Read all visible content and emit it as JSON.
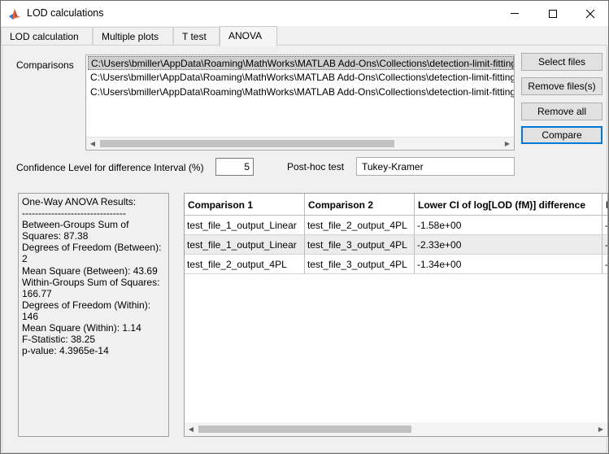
{
  "window": {
    "title": "LOD calculations",
    "icon": "matlab-icon"
  },
  "tabs": [
    {
      "label": "LOD calculation",
      "active": false
    },
    {
      "label": "Multiple plots",
      "active": false
    },
    {
      "label": "T test",
      "active": false
    },
    {
      "label": "ANOVA",
      "active": true
    }
  ],
  "comparisons": {
    "label": "Comparisons",
    "files": [
      "C:\\Users\\bmiller\\AppData\\Roaming\\MathWorks\\MATLAB Add-Ons\\Collections\\detection-limit-fitting",
      "C:\\Users\\bmiller\\AppData\\Roaming\\MathWorks\\MATLAB Add-Ons\\Collections\\detection-limit-fitting",
      "C:\\Users\\bmiller\\AppData\\Roaming\\MathWorks\\MATLAB Add-Ons\\Collections\\detection-limit-fitting"
    ],
    "selected_index": 0
  },
  "buttons": {
    "select_files": "Select files",
    "remove_files": "Remove files(s)",
    "remove_all": "Remove all",
    "compare": "Compare"
  },
  "confidence": {
    "label": "Confidence Level for difference Interval (%)",
    "value": "5"
  },
  "posthoc": {
    "label": "Post-hoc test",
    "selected": "Tukey-Kramer"
  },
  "results": {
    "lines": [
      "One-Way ANOVA Results:",
      "--------------------------------",
      "Between-Groups Sum of Squares: 87.38",
      "Degrees of Freedom (Between): 2",
      "Mean Square (Between): 43.69",
      "Within-Groups Sum of Squares: 166.77",
      "Degrees of Freedom (Within): 146",
      "Mean Square (Within): 1.14",
      "F-Statistic: 38.25",
      "p-value: 4.3965e-14"
    ]
  },
  "table": {
    "columns": [
      "Comparison 1",
      "Comparison 2",
      "Lower CI of log[LOD (fM)] difference",
      "L"
    ],
    "rows": [
      [
        "test_file_1_output_Linear",
        "test_file_2_output_4PL",
        "-1.58e+00",
        "-"
      ],
      [
        "test_file_1_output_Linear",
        "test_file_3_output_4PL",
        "-2.33e+00",
        "-"
      ],
      [
        "test_file_2_output_4PL",
        "test_file_3_output_4PL",
        "-1.34e+00",
        "-"
      ]
    ]
  }
}
